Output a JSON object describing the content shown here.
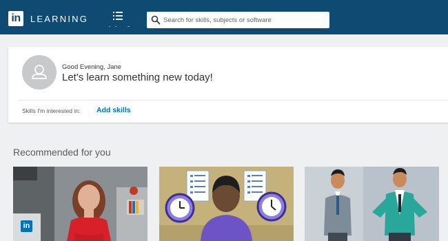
{
  "header": {
    "logo_text": "in",
    "brand": "LEARNING",
    "search": {
      "placeholder": "Search for skills, subjects or software"
    }
  },
  "greeting": {
    "small": "Good Evening, Jane",
    "headline": "Let's learn something new today!",
    "skills_label": "Skills I'm interested in:",
    "add_skills": "Add skills"
  },
  "recommended": {
    "title": "Recommended for you",
    "badge": "in"
  },
  "colors": {
    "topbar": "#0e4a72",
    "link": "#0073b1",
    "page_bg": "#eef0f1"
  }
}
